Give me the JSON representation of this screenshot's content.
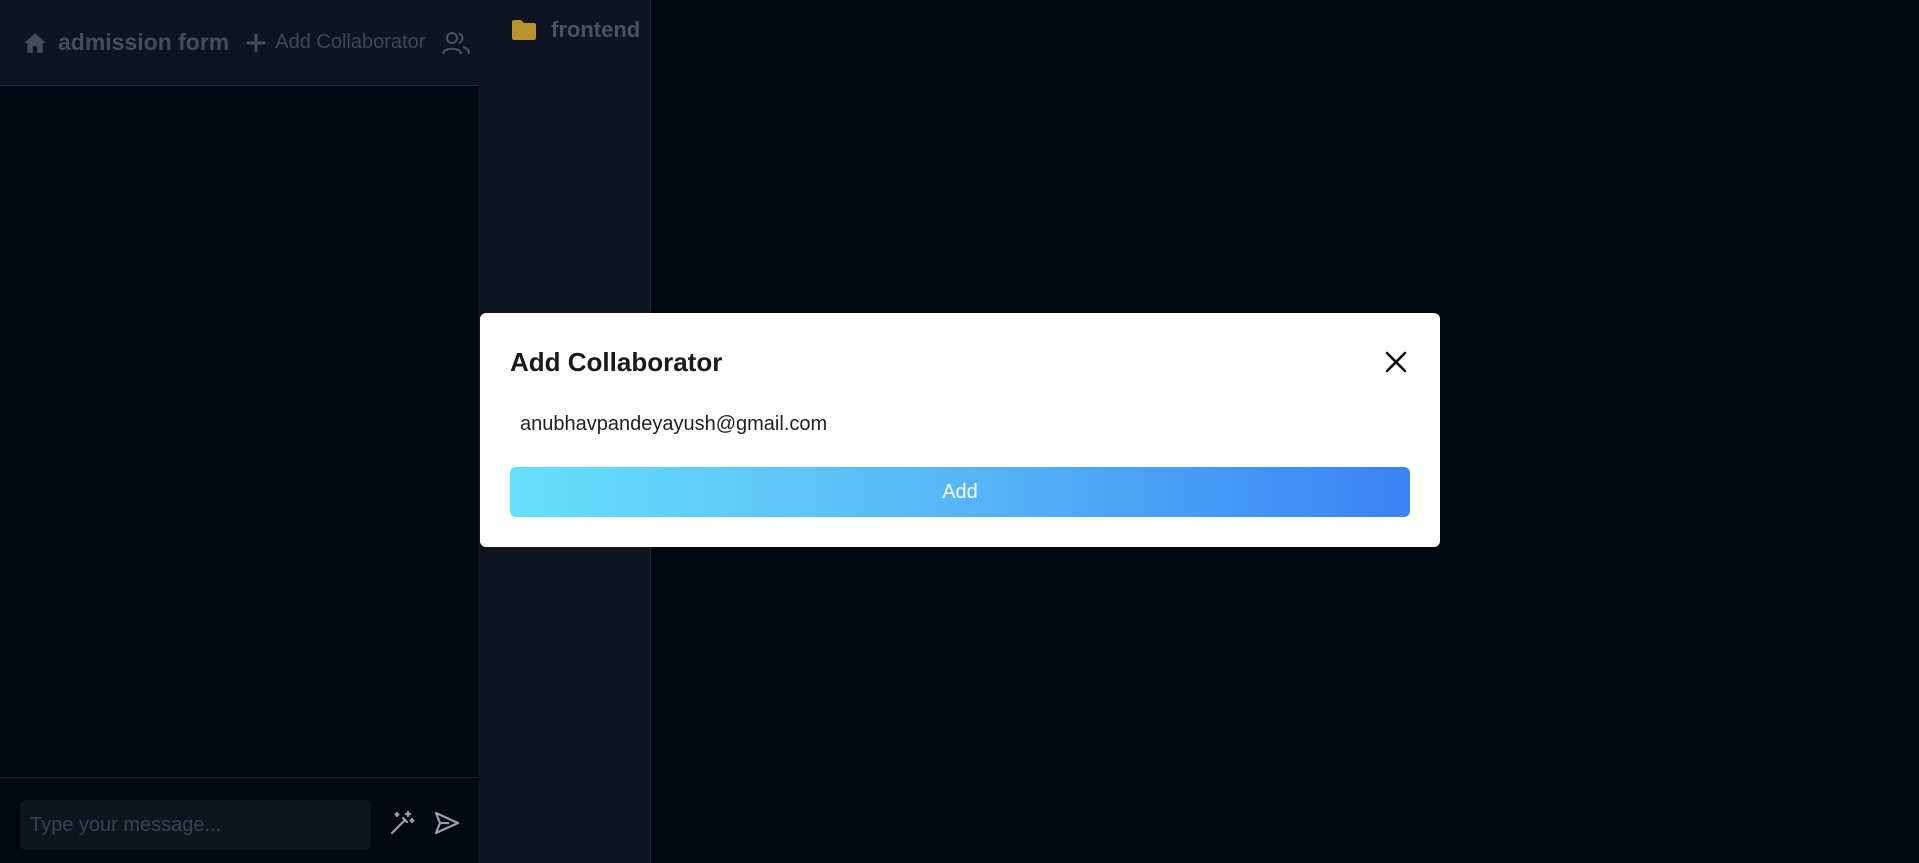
{
  "header": {
    "project_name": "admission form",
    "add_collaborator_label": "Add Collaborator",
    "icons": {
      "home": "home-icon",
      "add": "plus-icon",
      "users": "users-icon"
    }
  },
  "chat": {
    "input_placeholder": "Type your message...",
    "input_value": "",
    "icons": {
      "ai": "magic-wand-icon",
      "send": "send-icon"
    }
  },
  "explorer": {
    "items": [
      {
        "label": "frontend",
        "icon": "folder-icon"
      }
    ]
  },
  "modal": {
    "title": "Add Collaborator",
    "email_value": "anubhavpandeyayush@gmail.com",
    "add_button_label": "Add",
    "close_icon": "close-icon"
  },
  "colors": {
    "background": "#020812",
    "panel": "#0f1420",
    "folder": "#b8922a",
    "button_gradient_start": "#66e0fb",
    "button_gradient_end": "#3b82f6"
  }
}
